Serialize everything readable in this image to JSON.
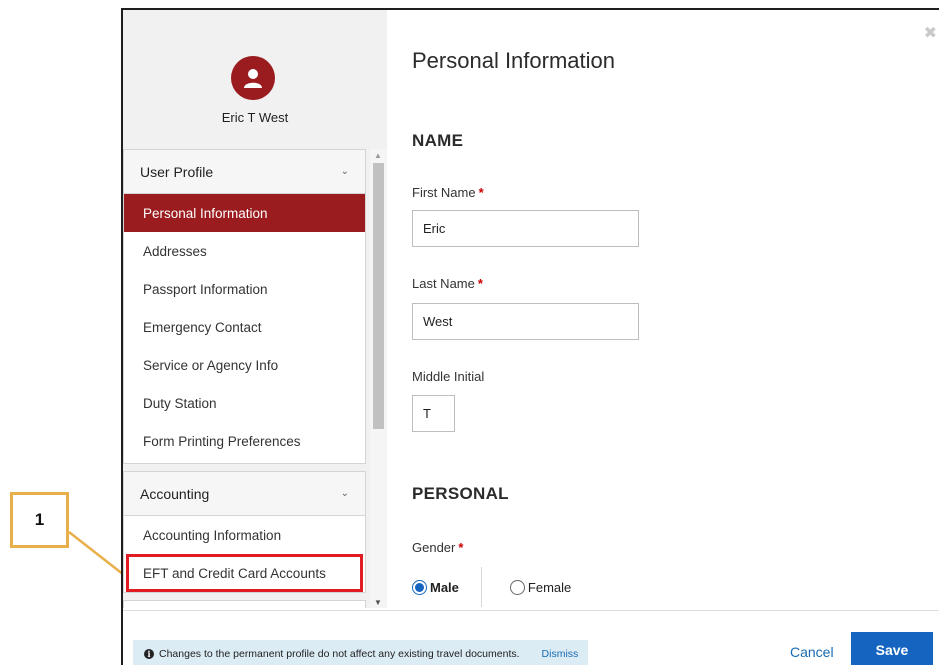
{
  "user": {
    "name": "Eric T West",
    "avatar_icon": "user-icon"
  },
  "sidebar": {
    "groups": [
      {
        "title": "User Profile",
        "items": [
          {
            "label": "Personal Information",
            "active": true
          },
          {
            "label": "Addresses"
          },
          {
            "label": "Passport Information"
          },
          {
            "label": "Emergency Contact"
          },
          {
            "label": "Service or Agency Info"
          },
          {
            "label": "Duty Station"
          },
          {
            "label": "Form Printing Preferences"
          }
        ]
      },
      {
        "title": "Accounting",
        "items": [
          {
            "label": "Accounting Information"
          },
          {
            "label": "EFT and Credit Card Accounts",
            "highlighted": true
          }
        ]
      }
    ]
  },
  "main": {
    "title": "Personal Information",
    "sections": {
      "name": "NAME",
      "personal": "PERSONAL"
    },
    "fields": {
      "first_name": {
        "label": "First Name",
        "required_mark": "*",
        "value": "Eric"
      },
      "last_name": {
        "label": "Last Name",
        "required_mark": "*",
        "value": "West"
      },
      "middle_initial": {
        "label": "Middle Initial",
        "value": "T"
      },
      "gender": {
        "label": "Gender",
        "required_mark": "*",
        "options": [
          "Male",
          "Female"
        ],
        "selected": "Male"
      }
    }
  },
  "footer": {
    "notice": "Changes to the permanent profile do not affect any existing travel documents.",
    "dismiss": "Dismiss",
    "cancel": "Cancel",
    "save": "Save"
  },
  "callout": {
    "label": "1",
    "color": "#e8b04a"
  },
  "colors": {
    "accent": "#9a1c1f",
    "primary": "#1565c0",
    "highlight": "#e01b22"
  }
}
